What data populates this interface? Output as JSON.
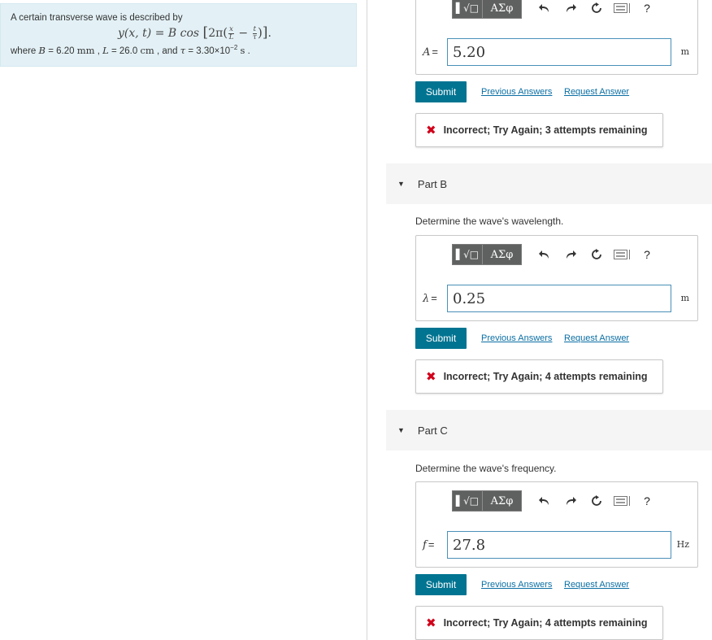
{
  "problem": {
    "intro": "A certain transverse wave is described by",
    "equation_lhs": "y(x, t) = B cos",
    "where_prefix": "where",
    "B_sym": "B",
    "B_val": "= 6.20",
    "B_unit": "mm",
    "L_sym": "L",
    "L_val": "= 26.0",
    "L_unit": "cm",
    "tau_sym": "τ",
    "tau_val": "= 3.30×10",
    "tau_exp": "−2",
    "tau_unit": "s"
  },
  "toolbar": {
    "templates_label": "▌√□",
    "symbols_label": "ΑΣφ",
    "help_label": "?"
  },
  "partA": {
    "variable": "A",
    "answer_value": "5.20",
    "unit": "m",
    "submit_label": "Submit",
    "previous_answers_label": "Previous Answers",
    "request_answer_label": "Request Answer",
    "feedback": "Incorrect; Try Again; 3 attempts remaining"
  },
  "partB": {
    "title": "Part B",
    "prompt": "Determine the wave's wavelength.",
    "variable": "λ",
    "answer_value": "0.25",
    "unit": "m",
    "submit_label": "Submit",
    "previous_answers_label": "Previous Answers",
    "request_answer_label": "Request Answer",
    "feedback": "Incorrect; Try Again; 4 attempts remaining"
  },
  "partC": {
    "title": "Part C",
    "prompt": "Determine the wave's frequency.",
    "variable": "f",
    "answer_value": "27.8",
    "unit": "Hz",
    "submit_label": "Submit",
    "previous_answers_label": "Previous Answers",
    "request_answer_label": "Request Answer",
    "feedback": "Incorrect; Try Again; 4 attempts remaining"
  },
  "icons": [
    "undo-icon",
    "redo-icon",
    "reset-icon",
    "keyboard-icon",
    "error-icon",
    "expand-caret-icon"
  ],
  "colors": {
    "submit": "#007491",
    "link": "#0b6fa4",
    "error": "#d0021b",
    "problem_bg": "#e3f1f6"
  }
}
